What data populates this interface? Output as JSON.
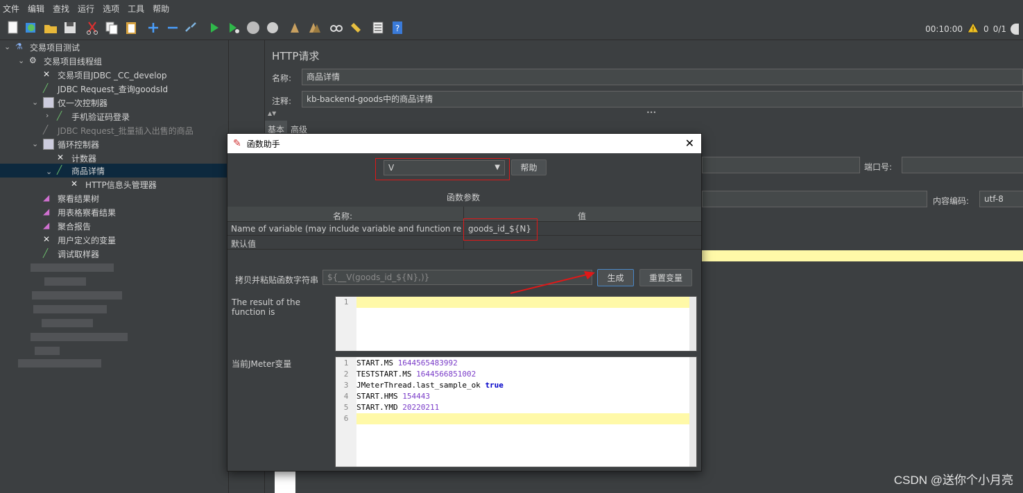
{
  "menu": [
    "文件",
    "编辑",
    "查找",
    "运行",
    "选项",
    "工具",
    "帮助"
  ],
  "status": {
    "timer": "00:10:00",
    "warnings": "0",
    "threads": "0/1"
  },
  "tree": {
    "root": "交易项目测试",
    "thread_group": "交易项目线程组",
    "jdbc_config": "交易项目JDBC _CC_develop",
    "jdbc_request": "JDBC Request_查询goodsId",
    "once_ctrl": "仅一次控制器",
    "login": "手机验证码登录",
    "jdbc_insert": "JDBC Request_批量插入出售的商品",
    "loop_ctrl": "循环控制器",
    "counter": "计数器",
    "detail": "商品详情",
    "header_mgr": "HTTP信息头管理器",
    "view_tree": "察看结果树",
    "view_table": "用表格察看结果",
    "aggregate": "聚合报告",
    "user_vars": "用户定义的变量",
    "debug": "调试取样器"
  },
  "http_panel": {
    "title": "HTTP请求",
    "name_label": "名称:",
    "name_value": "商品详情",
    "comment_label": "注释:",
    "comment_value": "kb-backend-goods中的商品详情",
    "tab_basic": "基本",
    "tab_advanced": "高级",
    "port_label": "端口号:",
    "encoding_label": "内容编码:",
    "encoding_value": "utf-8",
    "dots": "•••"
  },
  "dialog": {
    "title": "函数助手",
    "function_selected": "V",
    "help_button": "帮助",
    "params_title": "函数参数",
    "col_name": "名称:",
    "col_value": "值",
    "rows": [
      {
        "name": "Name of variable (may include variable and function referenc...",
        "value": "goods_id_${N}"
      },
      {
        "name": "默认值",
        "value": ""
      }
    ],
    "copy_label": "拷贝并粘贴函数字符串",
    "function_string": "${__V(goods_id_${N},)}",
    "generate_button": "生成",
    "reset_button": "重置变量",
    "result_label": "The result of the function is",
    "vars_label": "当前JMeter变量",
    "vars": [
      {
        "key": "START.MS",
        "val": "1644565483992"
      },
      {
        "key": "TESTSTART.MS",
        "val": "1644566851002"
      },
      {
        "key": "JMeterThread.last_sample_ok",
        "val": "true"
      },
      {
        "key": "START.HMS",
        "val": "154443"
      },
      {
        "key": "START.YMD",
        "val": "20220211"
      },
      {
        "key": "",
        "val": ""
      }
    ]
  },
  "colors": {
    "accent": "#e01818",
    "bg": "#3c3f41",
    "var_value": "#7a3cc8",
    "keyword": "#0000c8"
  },
  "watermark": "CSDN @送你个小月亮"
}
